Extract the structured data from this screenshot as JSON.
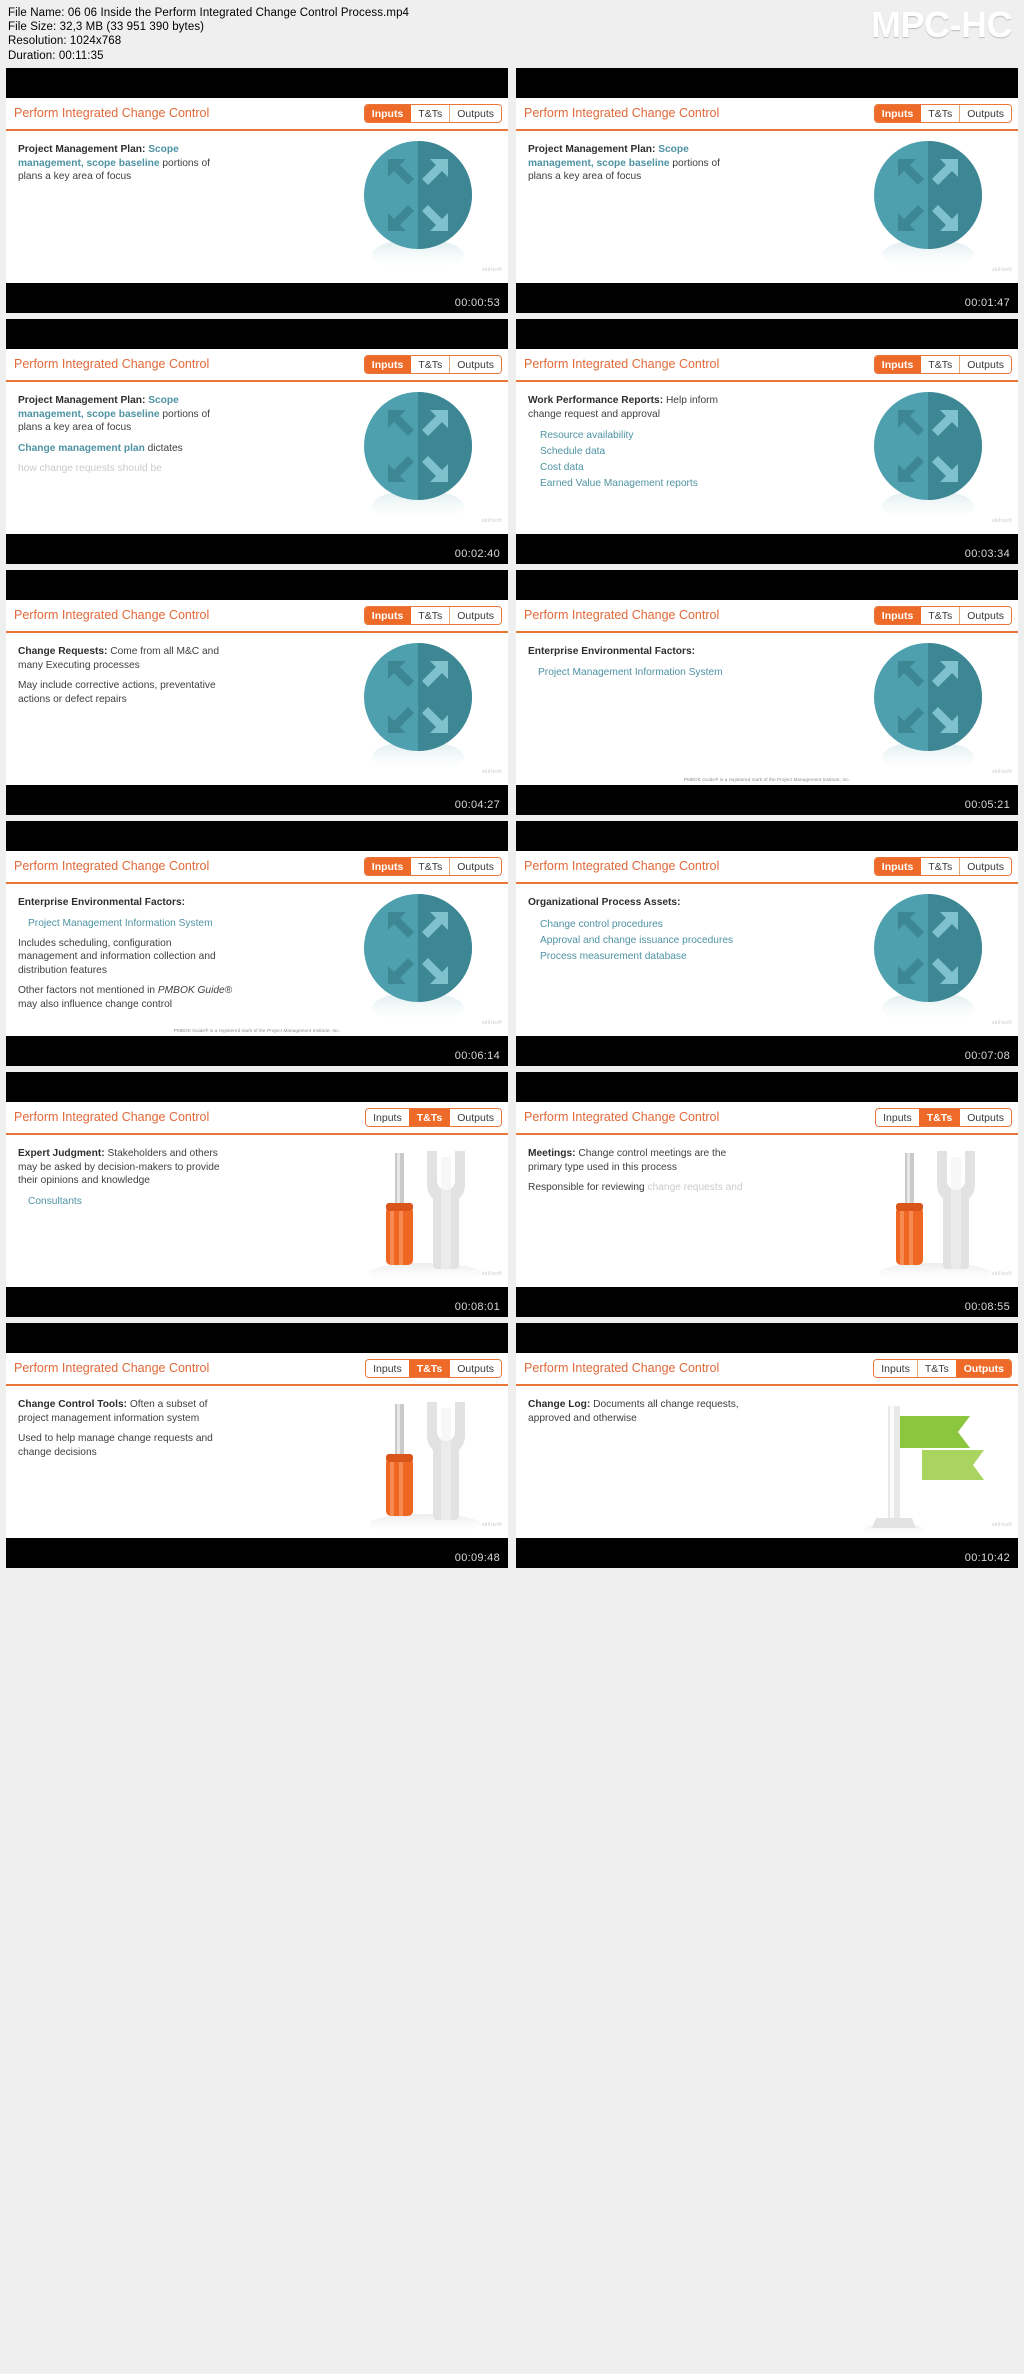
{
  "header": {
    "file_name_label": "File Name: 06 06 Inside the Perform Integrated Change Control Process.mp4",
    "file_size_label": "File Size: 32,3 MB (33 951 390 bytes)",
    "resolution_label": "Resolution: 1024x768",
    "duration_label": "Duration: 00:11:35",
    "brand": "MPC-HC"
  },
  "colors": {
    "accent_orange": "#ee6a28",
    "title_orange": "#e2693a",
    "teal": "#4e93a4",
    "circle_teal": "#4fa0ae",
    "circle_teal_dark": "#3d8795",
    "page_bg": "#efefef",
    "letterbox": "#000000"
  },
  "tabs": [
    "Inputs",
    "T&Ts",
    "Outputs"
  ],
  "footnote": "PMBOK Guide® is a registered mark of the Project Management Institute, Inc.",
  "watermark": "skillsoft",
  "thumbnails": [
    {
      "timestamp": "00:00:53",
      "title": "Perform Integrated Change Control",
      "active_tab": "Inputs",
      "art": "circle-arrows",
      "footnote": false,
      "blocks": [
        {
          "type": "para",
          "runs": [
            {
              "text": "Project Management Plan: ",
              "style": "bold"
            },
            {
              "text": "Scope management, scope baseline ",
              "style": "teal-bold"
            },
            {
              "text": "portions of plans a key area of focus",
              "style": "normal"
            }
          ]
        }
      ]
    },
    {
      "timestamp": "00:01:47",
      "title": "Perform Integrated Change Control",
      "active_tab": "Inputs",
      "art": "circle-arrows",
      "footnote": false,
      "blocks": [
        {
          "type": "para",
          "runs": [
            {
              "text": "Project Management Plan: ",
              "style": "bold"
            },
            {
              "text": "Scope management, scope baseline ",
              "style": "teal-bold"
            },
            {
              "text": "portions of plans a key area of focus",
              "style": "normal"
            }
          ]
        }
      ]
    },
    {
      "timestamp": "00:02:40",
      "title": "Perform Integrated Change Control",
      "active_tab": "Inputs",
      "art": "circle-arrows",
      "footnote": false,
      "blocks": [
        {
          "type": "para",
          "runs": [
            {
              "text": "Project Management Plan: ",
              "style": "bold"
            },
            {
              "text": "Scope management, scope baseline ",
              "style": "teal-bold"
            },
            {
              "text": "portions of plans a key area of focus",
              "style": "normal"
            }
          ]
        },
        {
          "type": "para",
          "runs": [
            {
              "text": "Change management plan ",
              "style": "teal-bold"
            },
            {
              "text": "dictates",
              "style": "normal"
            }
          ]
        },
        {
          "type": "para",
          "faded": true,
          "runs": [
            {
              "text": "how change requests should be",
              "style": "normal"
            }
          ]
        }
      ]
    },
    {
      "timestamp": "00:03:34",
      "title": "Perform Integrated Change Control",
      "active_tab": "Inputs",
      "art": "circle-arrows",
      "footnote": false,
      "blocks": [
        {
          "type": "para",
          "runs": [
            {
              "text": "Work Performance Reports: ",
              "style": "bold"
            },
            {
              "text": "Help inform change request and approval",
              "style": "normal"
            }
          ]
        },
        {
          "type": "bullets",
          "items": [
            "Resource availability",
            "Schedule data",
            "Cost data",
            "Earned Value Management reports"
          ]
        }
      ]
    },
    {
      "timestamp": "00:04:27",
      "title": "Perform Integrated Change Control",
      "active_tab": "Inputs",
      "art": "circle-arrows",
      "footnote": false,
      "blocks": [
        {
          "type": "para",
          "runs": [
            {
              "text": "Change Requests: ",
              "style": "bold"
            },
            {
              "text": "Come from all M&C and many Executing processes",
              "style": "normal"
            }
          ]
        },
        {
          "type": "para",
          "runs": [
            {
              "text": "May include corrective actions, preventative actions or defect repairs",
              "style": "normal"
            }
          ]
        }
      ]
    },
    {
      "timestamp": "00:05:21",
      "title": "Perform Integrated Change Control",
      "active_tab": "Inputs",
      "art": "circle-arrows",
      "footnote": true,
      "blocks": [
        {
          "type": "para",
          "runs": [
            {
              "text": "Enterprise Environmental Factors:",
              "style": "bold"
            }
          ]
        },
        {
          "type": "sub",
          "text": "Project Management Information System"
        }
      ]
    },
    {
      "timestamp": "00:06:14",
      "title": "Perform Integrated Change Control",
      "active_tab": "Inputs",
      "art": "circle-arrows",
      "footnote": true,
      "blocks": [
        {
          "type": "para",
          "runs": [
            {
              "text": "Enterprise Environmental Factors:",
              "style": "bold"
            }
          ]
        },
        {
          "type": "sub",
          "text": "Project Management Information System"
        },
        {
          "type": "para",
          "runs": [
            {
              "text": "Includes scheduling, configuration management and information collection and distribution features",
              "style": "normal"
            }
          ]
        },
        {
          "type": "para",
          "runs": [
            {
              "text": "Other factors not mentioned in ",
              "style": "normal"
            },
            {
              "text": "PMBOK Guide",
              "style": "italic"
            },
            {
              "text": "® may also influence change control",
              "style": "normal"
            }
          ]
        }
      ]
    },
    {
      "timestamp": "00:07:08",
      "title": "Perform Integrated Change Control",
      "active_tab": "Inputs",
      "art": "circle-arrows",
      "footnote": false,
      "blocks": [
        {
          "type": "para",
          "runs": [
            {
              "text": "Organizational Process Assets:",
              "style": "bold"
            }
          ]
        },
        {
          "type": "bullets",
          "items": [
            "Change control procedures",
            "Approval and change issuance procedures",
            "Process measurement database"
          ]
        }
      ]
    },
    {
      "timestamp": "00:08:01",
      "title": "Perform Integrated Change Control",
      "active_tab": "T&Ts",
      "art": "tools",
      "footnote": false,
      "blocks": [
        {
          "type": "para",
          "runs": [
            {
              "text": "Expert Judgment: ",
              "style": "bold"
            },
            {
              "text": "Stakeholders and others may be asked by decision-makers to provide their opinions and knowledge",
              "style": "normal"
            }
          ]
        },
        {
          "type": "sub",
          "text": "Consultants"
        }
      ]
    },
    {
      "timestamp": "00:08:55",
      "title": "Perform Integrated Change Control",
      "active_tab": "T&Ts",
      "art": "tools",
      "footnote": false,
      "blocks": [
        {
          "type": "para",
          "runs": [
            {
              "text": "Meetings: ",
              "style": "bold"
            },
            {
              "text": "Change control meetings are the primary type used in this process",
              "style": "normal"
            }
          ]
        },
        {
          "type": "para",
          "runs": [
            {
              "text": "Responsible for reviewing ",
              "style": "normal"
            },
            {
              "text": "change requests and",
              "style": "faded-run"
            }
          ]
        }
      ]
    },
    {
      "timestamp": "00:09:48",
      "title": "Perform Integrated Change Control",
      "active_tab": "T&Ts",
      "art": "tools",
      "footnote": false,
      "blocks": [
        {
          "type": "para",
          "runs": [
            {
              "text": "Change Control Tools: ",
              "style": "bold"
            },
            {
              "text": "Often a subset of project management information system",
              "style": "normal"
            }
          ]
        },
        {
          "type": "para",
          "runs": [
            {
              "text": "Used to help manage change requests and change decisions",
              "style": "normal"
            }
          ]
        }
      ]
    },
    {
      "timestamp": "00:10:42",
      "title": "Perform Integrated Change Control",
      "active_tab": "Outputs",
      "art": "log",
      "footnote": false,
      "blocks": [
        {
          "type": "para",
          "runs": [
            {
              "text": "Change Log: ",
              "style": "bold"
            },
            {
              "text": "Documents all change requests, approved and otherwise",
              "style": "normal"
            }
          ]
        }
      ]
    }
  ]
}
